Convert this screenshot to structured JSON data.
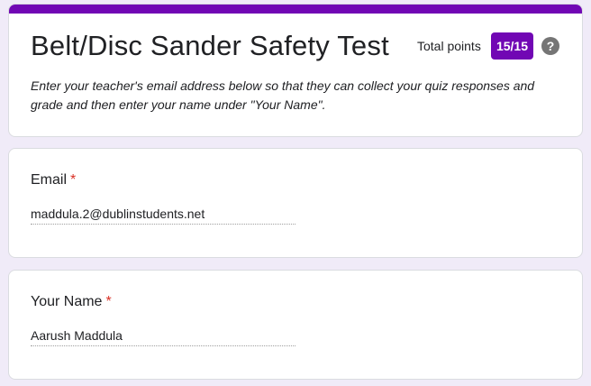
{
  "form": {
    "title": "Belt/Disc Sander Safety Test",
    "points_label": "Total points",
    "score": "15/15",
    "help_glyph": "?",
    "description": "Enter your teacher's email address below so that they can collect your quiz responses and grade and then enter your name under \"Your Name\".",
    "accent_color": "#7107b4"
  },
  "questions": [
    {
      "title": "Email",
      "required_mark": "*",
      "answer": "maddula.2@dublinstudents.net"
    },
    {
      "title": "Your Name",
      "required_mark": "*",
      "answer": "Aarush Maddula"
    }
  ]
}
